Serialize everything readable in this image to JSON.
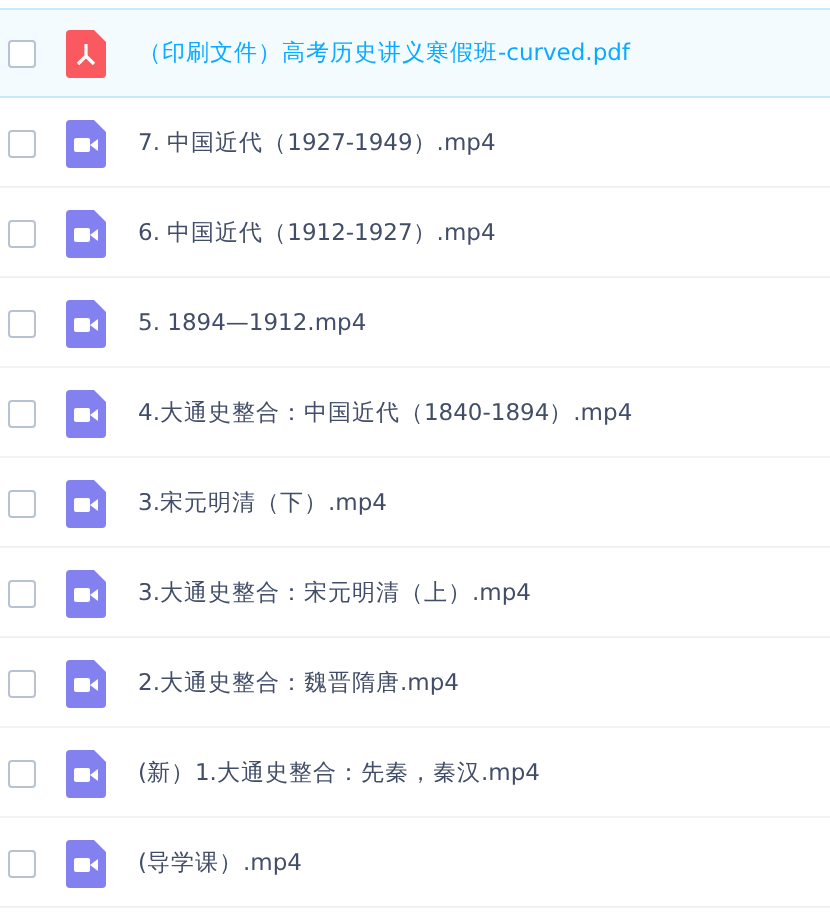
{
  "files": [
    {
      "name": "（印刷文件）高考历史讲义寒假班-curved.pdf",
      "kind": "pdf",
      "selected": true,
      "checked": false
    },
    {
      "name": "7. 中国近代（1927-1949）.mp4",
      "kind": "video",
      "selected": false,
      "checked": false
    },
    {
      "name": "6. 中国近代（1912-1927）.mp4",
      "kind": "video",
      "selected": false,
      "checked": false
    },
    {
      "name": "5. 1894—1912.mp4",
      "kind": "video",
      "selected": false,
      "checked": false
    },
    {
      "name": "4.大通史整合：中国近代（1840-1894）.mp4",
      "kind": "video",
      "selected": false,
      "checked": false
    },
    {
      "name": "3.宋元明清（下）.mp4",
      "kind": "video",
      "selected": false,
      "checked": false
    },
    {
      "name": "3.大通史整合：宋元明清（上）.mp4",
      "kind": "video",
      "selected": false,
      "checked": false
    },
    {
      "name": "2.大通史整合：魏晋隋唐.mp4",
      "kind": "video",
      "selected": false,
      "checked": false
    },
    {
      "name": "(新）1.大通史整合：先秦，秦汉.mp4",
      "kind": "video",
      "selected": false,
      "checked": false
    },
    {
      "name": "(导学课）.mp4",
      "kind": "video",
      "selected": false,
      "checked": false
    }
  ]
}
